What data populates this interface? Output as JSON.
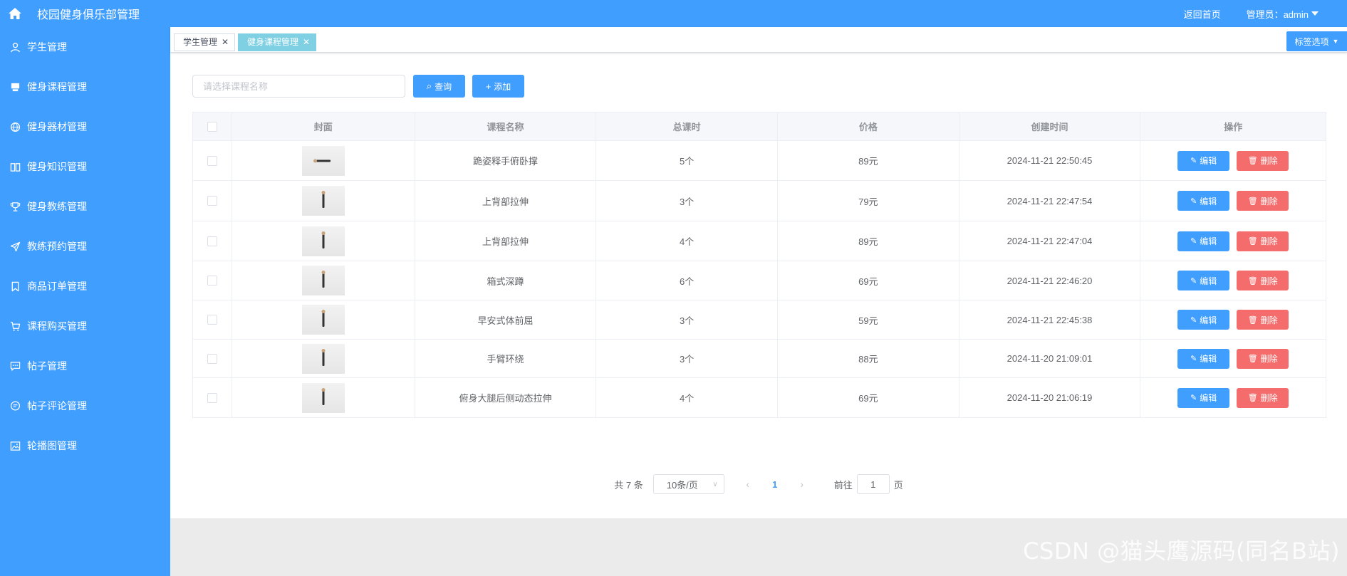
{
  "header": {
    "title": "校园健身俱乐部管理",
    "back_home": "返回首页",
    "admin_label": "管理员：admin"
  },
  "sidebar": {
    "items": [
      {
        "label": "学生管理",
        "icon": "user-icon"
      },
      {
        "label": "健身课程管理",
        "icon": "monitor-icon"
      },
      {
        "label": "健身器材管理",
        "icon": "basketball-icon"
      },
      {
        "label": "健身知识管理",
        "icon": "book-icon"
      },
      {
        "label": "健身教练管理",
        "icon": "trophy-icon"
      },
      {
        "label": "教练预约管理",
        "icon": "paper-plane-icon"
      },
      {
        "label": "商品订单管理",
        "icon": "bookmark-icon"
      },
      {
        "label": "课程购买管理",
        "icon": "cart-icon"
      },
      {
        "label": "帖子管理",
        "icon": "chat-dots-icon"
      },
      {
        "label": "帖子评论管理",
        "icon": "chat-lines-icon"
      },
      {
        "label": "轮播图管理",
        "icon": "picture-icon"
      }
    ]
  },
  "tabs": {
    "items": [
      {
        "label": "学生管理",
        "active": false
      },
      {
        "label": "健身课程管理",
        "active": true
      }
    ],
    "options_label": "标签选项"
  },
  "toolbar": {
    "search_placeholder": "请选择课程名称",
    "query_label": "查询",
    "add_label": "添加"
  },
  "table": {
    "columns": [
      "封面",
      "课程名称",
      "总课时",
      "价格",
      "创建时间",
      "操作"
    ],
    "edit_label": "编辑",
    "delete_label": "删除",
    "rows": [
      {
        "name": "跪姿释手俯卧撑",
        "hours": "5个",
        "price": "89元",
        "created": "2024-11-21 22:50:45"
      },
      {
        "name": "上背部拉伸",
        "hours": "3个",
        "price": "79元",
        "created": "2024-11-21 22:47:54"
      },
      {
        "name": "上背部拉伸",
        "hours": "4个",
        "price": "89元",
        "created": "2024-11-21 22:47:04"
      },
      {
        "name": "箱式深蹲",
        "hours": "6个",
        "price": "69元",
        "created": "2024-11-21 22:46:20"
      },
      {
        "name": "早安式体前屈",
        "hours": "3个",
        "price": "59元",
        "created": "2024-11-21 22:45:38"
      },
      {
        "name": "手臂环绕",
        "hours": "3个",
        "price": "88元",
        "created": "2024-11-20 21:09:01"
      },
      {
        "name": "俯身大腿后侧动态拉伸",
        "hours": "4个",
        "price": "69元",
        "created": "2024-11-20 21:06:19"
      }
    ]
  },
  "pagination": {
    "total_label": "共 7 条",
    "page_size": "10条/页",
    "current_page": "1",
    "goto_label": "前往",
    "goto_value": "1",
    "page_suffix": "页"
  },
  "watermark": "CSDN @猫头鹰源码(同名B站)",
  "colors": {
    "primary": "#409eff",
    "danger": "#f56c6c",
    "active_tag": "#7fd0e3"
  }
}
